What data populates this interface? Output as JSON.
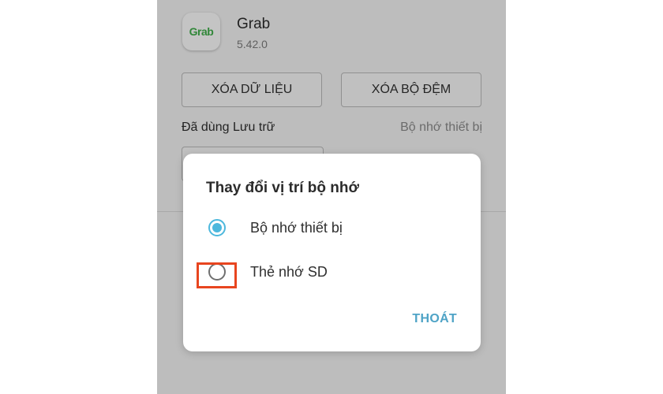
{
  "app": {
    "name": "Grab",
    "version": "5.42.0",
    "icon_text": "Grab",
    "icon_color": "#3fae49"
  },
  "actions": {
    "clear_data": "XÓA DỮ LIỆU",
    "clear_cache": "XÓA BỘ ĐỆM"
  },
  "storage": {
    "label": "Đã dùng Lưu trữ",
    "value": "Bộ nhớ thiết bị"
  },
  "dialog": {
    "title": "Thay đổi vị trí bộ nhớ",
    "options": [
      {
        "label": "Bộ nhớ thiết bị",
        "selected": true
      },
      {
        "label": "Thẻ nhớ SD",
        "selected": false
      }
    ],
    "exit_label": "THOÁT",
    "accent_color": "#4db8dd",
    "highlight_color": "#e8451f"
  }
}
